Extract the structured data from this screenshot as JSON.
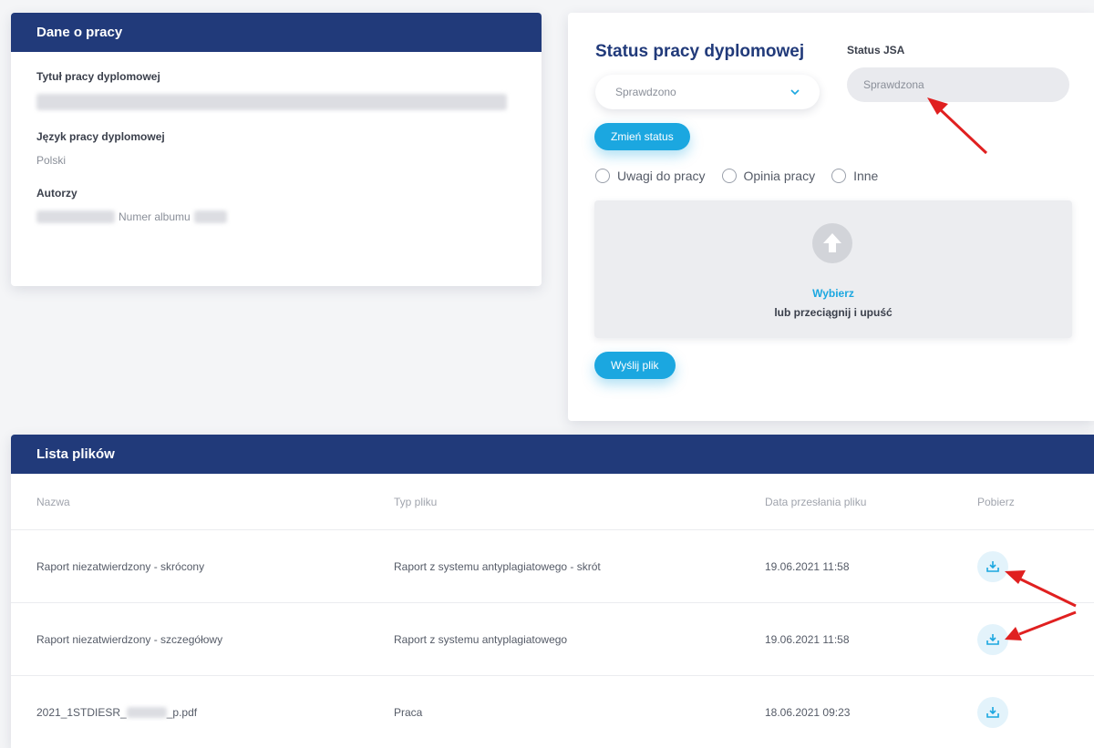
{
  "info_card": {
    "header": "Dane o pracy",
    "title_label": "Tytuł pracy dyplomowej",
    "language_label": "Język pracy dyplomowej",
    "language_value": "Polski",
    "authors_label": "Autorzy",
    "album_label": "Numer albumu"
  },
  "status_card": {
    "title": "Status pracy dyplomowej",
    "jsa_label": "Status JSA",
    "status_select_value": "Sprawdzono",
    "jsa_value": "Sprawdzona",
    "change_status_button": "Zmień status",
    "radio_options": [
      "Uwagi do pracy",
      "Opinia pracy",
      "Inne"
    ],
    "dropzone_choose": "Wybierz",
    "dropzone_drag": "lub przeciągnij i upuść",
    "send_file_button": "Wyślij plik"
  },
  "files_card": {
    "header": "Lista plików",
    "columns": [
      "Nazwa",
      "Typ pliku",
      "Data przesłania pliku",
      "Pobierz"
    ],
    "rows": [
      {
        "name": "Raport niezatwierdzony - skrócony",
        "type": "Raport z systemu antyplagiatowego - skrót",
        "date": "19.06.2021 11:58"
      },
      {
        "name": "Raport niezatwierdzony - szczegółowy",
        "type": "Raport z systemu antyplagiatowego",
        "date": "19.06.2021 11:58"
      },
      {
        "name_prefix": "2021_1STDIESR_",
        "name_suffix": "_p.pdf",
        "type": "Praca",
        "date": "18.06.2021 09:23"
      }
    ]
  },
  "colors": {
    "header_navy": "#213a7a",
    "accent_blue": "#1ba7e0",
    "annotation_red": "#e02020"
  },
  "icons": {
    "download": "download-icon",
    "upload": "upload-arrow-icon",
    "chevron": "chevron-down-icon"
  }
}
